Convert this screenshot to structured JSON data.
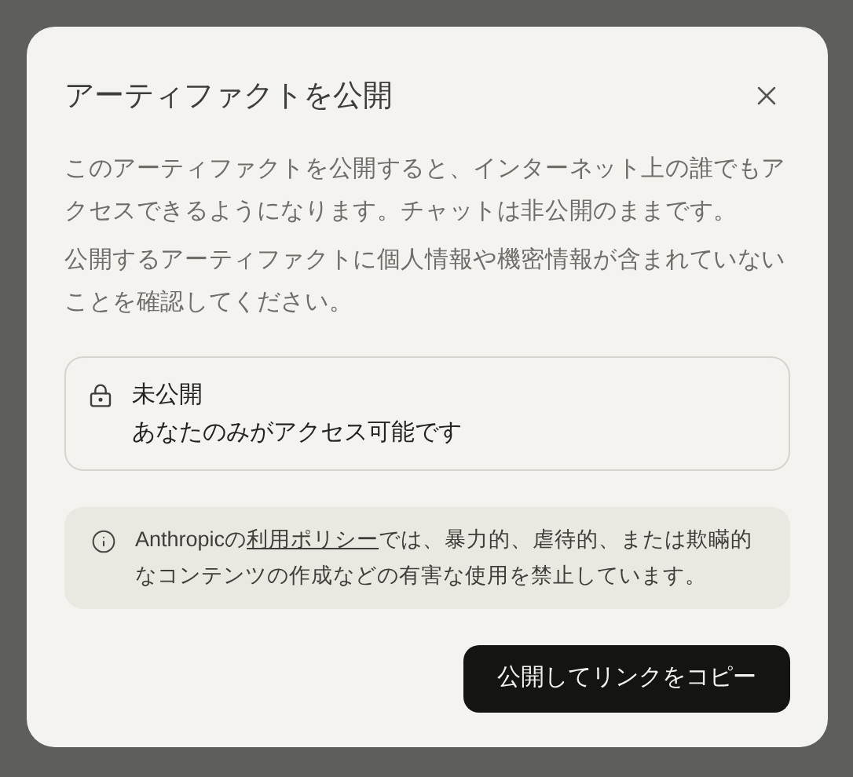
{
  "dialog": {
    "title": "アーティファクトを公開",
    "paragraphs": [
      "このアーティファクトを公開すると、インターネット上の誰でもアクセスできるようになります。チャットは非公開のままです。",
      "公開するアーティファクトに個人情報や機密情報が含まれていないことを確認してください。"
    ],
    "visibility": {
      "title": "未公開",
      "description": "あなたのみがアクセス可能です"
    },
    "notice": {
      "before": "Anthropicの",
      "link": "利用ポリシー",
      "after": "では、暴力的、虐待的、または欺瞞的なコンテンツの作成などの有害な使用を禁止しています。"
    },
    "button": "公開してリンクをコピー"
  }
}
